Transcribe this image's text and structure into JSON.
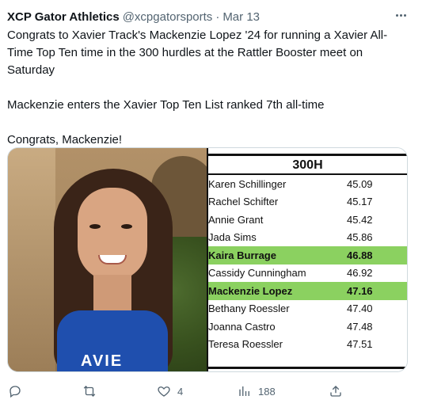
{
  "tweet": {
    "author_name": "XCP Gator Athletics",
    "handle": "@xcpgatorsports",
    "separator": "·",
    "date": "Mar 13",
    "text": {
      "paragraph1": "Congrats to Xavier Track's Mackenzie Lopez '24 for running a Xavier All-Time Top Ten time in the 300 hurdles at the Rattler Booster meet on Saturday",
      "paragraph2": "Mackenzie enters the Xavier Top Ten List ranked 7th all-time",
      "paragraph3": "Congrats, Mackenzie!"
    }
  },
  "media": {
    "photo_jersey_text": "AVIE",
    "table": {
      "heading": "300H",
      "rows": [
        {
          "name": "Karen Schillinger",
          "time": "45.09",
          "highlight": false
        },
        {
          "name": "Rachel Schifter",
          "time": "45.17",
          "highlight": false
        },
        {
          "name": "Annie Grant",
          "time": "45.42",
          "highlight": false
        },
        {
          "name": "Jada Sims",
          "time": "45.86",
          "highlight": false
        },
        {
          "name": "Kaira Burrage",
          "time": "46.88",
          "highlight": true
        },
        {
          "name": "Cassidy Cunningham",
          "time": "46.92",
          "highlight": false
        },
        {
          "name": "Mackenzie Lopez",
          "time": "47.16",
          "highlight": true
        },
        {
          "name": "Bethany Roessler",
          "time": "47.40",
          "highlight": false
        },
        {
          "name": "Joanna Castro",
          "time": "47.48",
          "highlight": false
        },
        {
          "name": "Teresa Roessler",
          "time": "47.51",
          "highlight": false
        }
      ],
      "highlight_color": "#8bd160"
    }
  },
  "actions": {
    "reply_count": "",
    "retweet_count": "",
    "like_count": "4",
    "views_count": "188",
    "icons": [
      "reply-icon",
      "retweet-icon",
      "like-icon",
      "views-icon",
      "share-icon"
    ]
  },
  "colors": {
    "text": "#0f1419",
    "muted": "#536471",
    "border": "#cfd9de"
  }
}
